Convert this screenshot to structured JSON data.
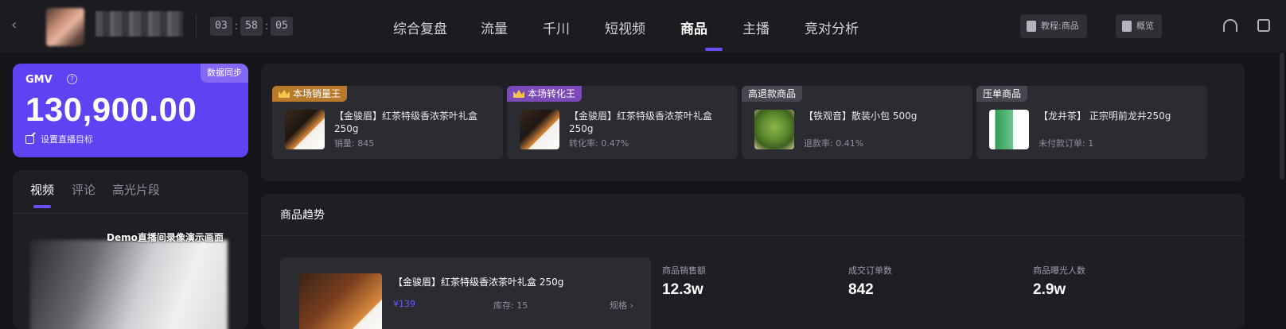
{
  "header": {
    "timer": {
      "h": "03",
      "m": "58",
      "s": "05"
    },
    "nav": [
      {
        "label": "综合复盘",
        "active": false
      },
      {
        "label": "流量",
        "active": false
      },
      {
        "label": "千川",
        "active": false
      },
      {
        "label": "短视频",
        "active": false
      },
      {
        "label": "商品",
        "active": true
      },
      {
        "label": "主播",
        "active": false
      },
      {
        "label": "竞对分析",
        "active": false
      }
    ],
    "tutorial_label": "教程:商品",
    "overview_label": "概览",
    "accent_color": "#6b4df6"
  },
  "gmv": {
    "label": "GMV",
    "sync_label": "数据同步",
    "value": "130,900.00",
    "target_label": "设置直播目标"
  },
  "video": {
    "tabs": [
      "视频",
      "评论",
      "高光片段"
    ],
    "active_tab": "视频",
    "caption": "Demo直播间录像演示画面"
  },
  "goods": [
    {
      "badge": "本场销量王",
      "badge_color": "#b87a2a",
      "title": "【金骏眉】红茶特级香浓茶叶礼盒250g",
      "meta": "销量: 845"
    },
    {
      "badge": "本场转化王",
      "badge_color": "#7a4bb8",
      "title": "【金骏眉】红茶特级香浓茶叶礼盒250g",
      "meta": "转化率: 0.47%"
    },
    {
      "badge": "高退款商品",
      "badge_color": "#46464f",
      "title": "【铁观音】散装小包 500g",
      "meta": "退款率: 0.41%"
    },
    {
      "badge": "压单商品",
      "badge_color": "#46464f",
      "title": "【龙井茶】 正宗明前龙井250g",
      "meta": "未付款订单: 1"
    }
  ],
  "trend": {
    "title": "商品趋势",
    "product": {
      "title": "【金骏眉】红茶特级香浓茶叶礼盒 250g",
      "price": "¥139",
      "stock": "库存: 15",
      "spec": "规格 ›"
    },
    "kpis": [
      {
        "label": "商品销售额",
        "value": "12.3w"
      },
      {
        "label": "成交订单数",
        "value": "842"
      },
      {
        "label": "商品曝光人数",
        "value": "2.9w"
      }
    ]
  }
}
